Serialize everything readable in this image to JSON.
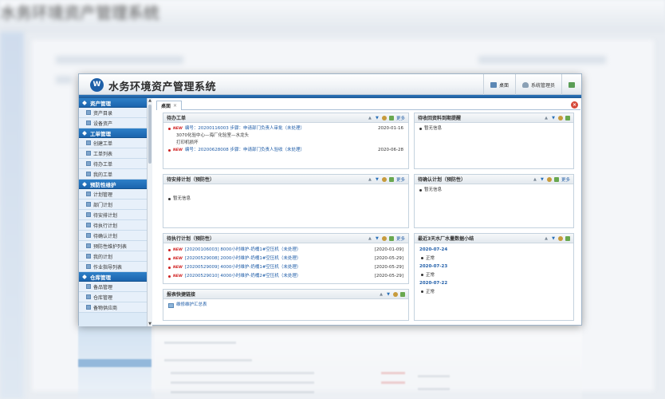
{
  "app": {
    "title": "水务环境资产管理系统",
    "logo_glyph": "W",
    "header_buttons": [
      {
        "label": "桌面",
        "icon": "desktop-icon"
      },
      {
        "label": "系统管理员",
        "icon": "user-icon"
      },
      {
        "label": "",
        "icon": "exit-icon"
      }
    ]
  },
  "sidebar": {
    "groups": [
      {
        "label": "资产管理",
        "items": [
          "资产目录",
          "设备资产"
        ]
      },
      {
        "label": "工单管理",
        "items": [
          "创建工单",
          "工单列表",
          "待办工单",
          "我的工单"
        ]
      },
      {
        "label": "预防性维护",
        "items": [
          "计划管理",
          "部门计划",
          "待安排计划",
          "待执行计划",
          "待确认计划",
          "预防性维护列表",
          "我的计划",
          "作业指导列表"
        ]
      },
      {
        "label": "仓库管理",
        "items": [
          "备品管理",
          "仓库管理",
          "备物供应商"
        ]
      }
    ]
  },
  "tabs": {
    "active": "桌面",
    "close_glyph": "×"
  },
  "portlets": {
    "todo": {
      "title": "待办工单",
      "more": "更多",
      "items": [
        {
          "text": "编号：20200116003 步骤：申请部门负责人审批（未处理）",
          "date": "2020-01-16",
          "sub1": "3070化验中心—海厂化验室—水龙头",
          "sub2": "打印机损坏"
        },
        {
          "text": "编号：20200628008 步骤：申请部门负责人验收（未处理）",
          "date": "2020-06-28",
          "sub1": "",
          "sub2": ""
        }
      ]
    },
    "pending_reports": {
      "title": "待收回资料到期提醒",
      "empty": "暂无信息"
    },
    "arrange": {
      "title": "待安排计划（预防性）",
      "more": "更多",
      "empty": "暂无信息"
    },
    "confirm": {
      "title": "待确认计划（预防性）",
      "more": "更多",
      "empty": "暂无信息"
    },
    "execute": {
      "title": "待执行计划（预防性）",
      "more": "更多",
      "items": [
        {
          "text": "[20200106003] 8000小时维护-奶桶1#空压机（未处理）",
          "date": "[2020-01-09]"
        },
        {
          "text": "[20200529008] 2000小时维护-奶桶1#空压机（未处理）",
          "date": "[2020-05-29]"
        },
        {
          "text": "[20200529009] 4000小时维护-奶桶1#空压机（未处理）",
          "date": "[2020-05-29]"
        },
        {
          "text": "[20200529010] 4000小时维护-奶桶2#空压机（未处理）",
          "date": "[2020-05-29]"
        }
      ]
    },
    "water": {
      "title": "最近3天水厂水量数据小结",
      "entries": [
        {
          "date": "2020-07-24",
          "status": "正常"
        },
        {
          "date": "2020-07-23",
          "status": "正常"
        },
        {
          "date": "2020-07-22",
          "status": "正常"
        }
      ]
    },
    "report_links": {
      "title": "报表快捷链接",
      "items": [
        "维修维护汇总表"
      ]
    }
  },
  "background": {
    "title": "水务环境资产管理系统"
  }
}
